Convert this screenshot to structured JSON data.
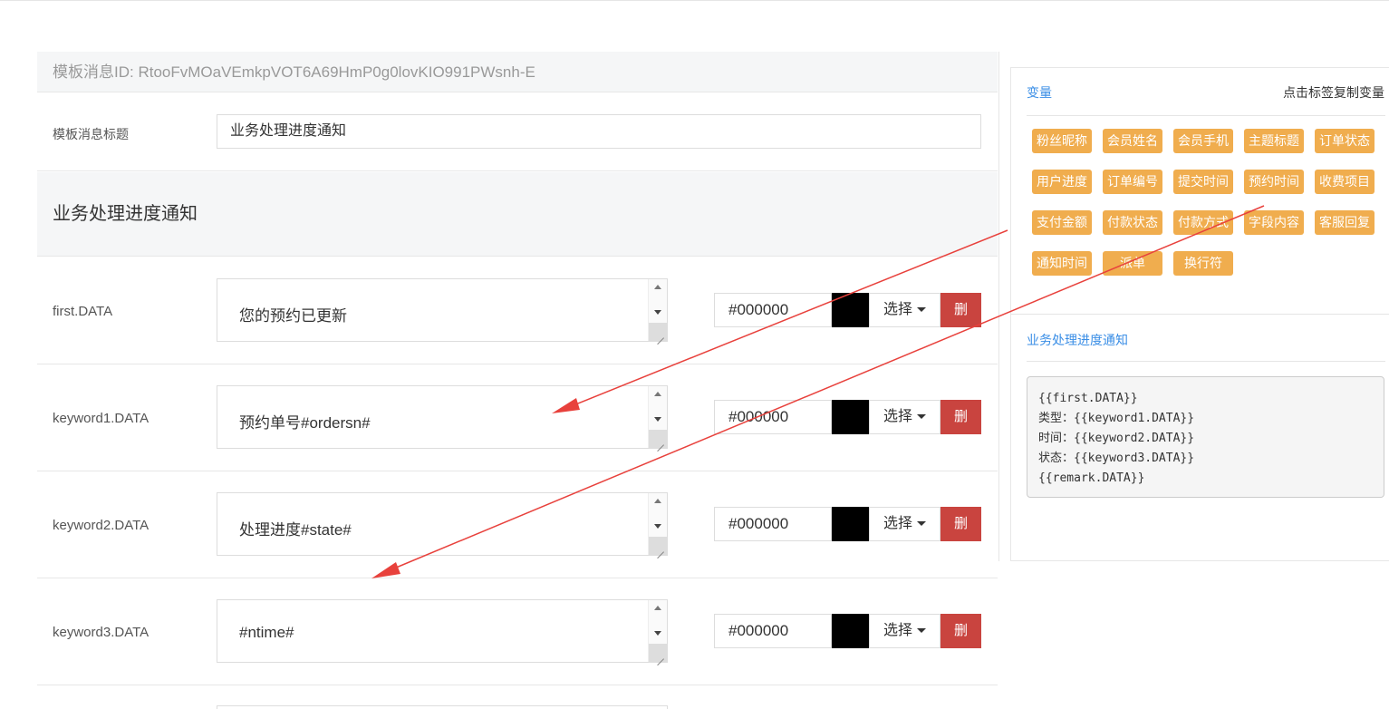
{
  "template": {
    "id_label": "模板消息ID: RtooFvMOaVEmkpVOT6A69HmP0g0lovKIO991PWsnh-E",
    "title_label": "模板消息标题",
    "title_value": "业务处理进度通知",
    "section_heading": "业务处理进度通知"
  },
  "fields": [
    {
      "label": "first.DATA",
      "value": "您的预约已更新",
      "color": "#000000",
      "choose": "选择",
      "delete": "删"
    },
    {
      "label": "keyword1.DATA",
      "value": "预约单号#ordersn#",
      "color": "#000000",
      "choose": "选择",
      "delete": "删"
    },
    {
      "label": "keyword2.DATA",
      "value": "处理进度#state#",
      "color": "#000000",
      "choose": "选择",
      "delete": "删"
    },
    {
      "label": "keyword3.DATA",
      "value": "#ntime#",
      "color": "#000000",
      "choose": "选择",
      "delete": "删"
    }
  ],
  "variables": {
    "heading": "变量",
    "hint": "点击标签复制变量",
    "tags": [
      "粉丝昵称",
      "会员姓名",
      "会员手机",
      "主题标题",
      "订单状态",
      "用户进度",
      "订单编号",
      "提交时间",
      "预约时间",
      "收费项目",
      "支付金额",
      "付款状态",
      "付款方式",
      "字段内容",
      "客服回复",
      "通知时间",
      "派单",
      "换行符"
    ]
  },
  "preview": {
    "name": "业务处理进度通知",
    "lines": [
      "{{first.DATA}}",
      "类型：{{keyword1.DATA}}",
      "时间：{{keyword2.DATA}}",
      "状态：{{keyword3.DATA}}",
      "{{remark.DATA}}"
    ]
  },
  "colors": {
    "tag_bg": "#f0ad4e",
    "delete_bg": "#c9443f",
    "link": "#3a8ee6",
    "annotation_arrow": "#e8413c"
  }
}
